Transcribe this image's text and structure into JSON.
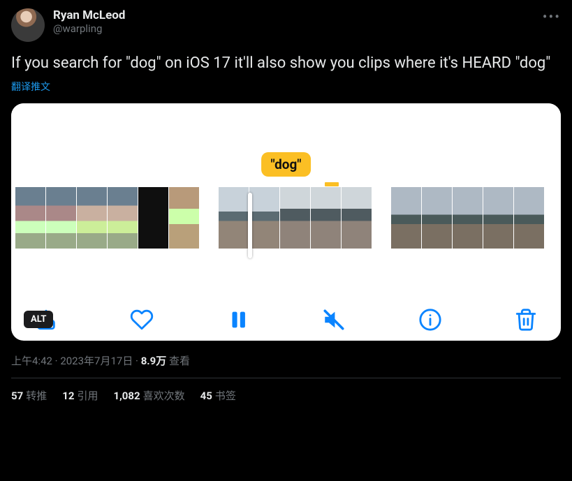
{
  "author": {
    "display_name": "Ryan McLeod",
    "handle": "@warpling"
  },
  "more_icon": "more",
  "body_text": "If you search for \"dog\" on iOS 17 it'll also show you clips where it's HEARD \"dog\"",
  "translate_label": "翻译推文",
  "media": {
    "caption_badge": "\"dog\"",
    "alt_label": "ALT",
    "toolbar": {
      "share": "share-icon",
      "like": "heart-icon",
      "pause": "pause-icon",
      "mute": "volume-mute-icon",
      "info": "info-icon",
      "delete": "trash-icon"
    }
  },
  "meta": {
    "time": "上午4:42",
    "dot1": " · ",
    "date": "2023年7月17日",
    "dot2": " · ",
    "views_count": "8.9万",
    "views_label": " 查看"
  },
  "stats": {
    "retweets": {
      "count": "57",
      "label": "转推"
    },
    "quotes": {
      "count": "12",
      "label": "引用"
    },
    "likes": {
      "count": "1,082",
      "label": "喜欢次数"
    },
    "bookmarks": {
      "count": "45",
      "label": "书签"
    }
  }
}
